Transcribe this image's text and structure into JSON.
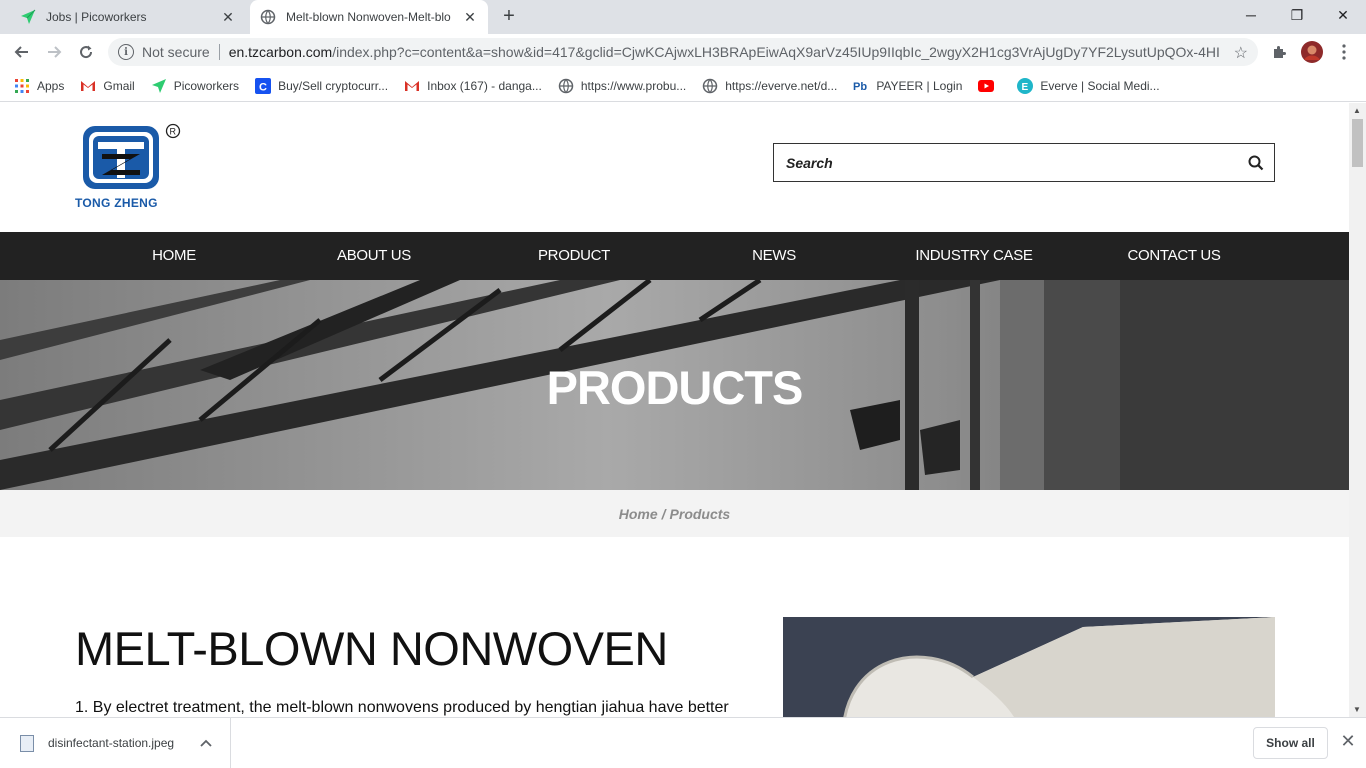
{
  "browser": {
    "tabs": [
      {
        "title": "Jobs | Picoworkers",
        "active": false,
        "icon": "paper-plane-icon"
      },
      {
        "title": "Melt-blown Nonwoven-Melt-blo",
        "active": true,
        "icon": "globe-icon"
      }
    ],
    "security_label": "Not secure",
    "url_host": "en.tzcarbon.com",
    "url_rest": "/index.php?c=content&a=show&id=417&gclid=CjwKCAjwxLH3BRApEiwAqX9arVz45IUp9IIqbIc_2wgyX2H1cg3VrAjUgDy7YF2LysutUpQOx-4HI..."
  },
  "bookmarks": [
    {
      "label": "Apps",
      "icon": "apps-grid-icon"
    },
    {
      "label": "Gmail",
      "icon": "gmail-icon"
    },
    {
      "label": "Picoworkers",
      "icon": "paper-plane-icon"
    },
    {
      "label": "Buy/Sell cryptocurr...",
      "icon": "c-logo-icon"
    },
    {
      "label": "Inbox (167) - danga...",
      "icon": "gmail-icon"
    },
    {
      "label": "https://www.probu...",
      "icon": "globe-icon"
    },
    {
      "label": "https://everve.net/d...",
      "icon": "globe-icon"
    },
    {
      "label": "PAYEER | Login",
      "icon": "payeer-icon"
    },
    {
      "label": "",
      "icon": "youtube-icon"
    },
    {
      "label": "Everve | Social Medi...",
      "icon": "everve-icon"
    }
  ],
  "site": {
    "logo_text": "TONG ZHENG",
    "search_placeholder": "Search",
    "nav": [
      "HOME",
      "ABOUT US",
      "PRODUCT",
      "NEWS",
      "INDUSTRY CASE",
      "CONTACT US"
    ],
    "banner_title": "PRODUCTS",
    "breadcrumb": {
      "home": "Home",
      "separator": "/",
      "current": "Products"
    },
    "product_title": "MELT-BLOWN NONWOVEN",
    "product_desc": "1. By electret treatment, the melt-blown nonwovens produced by hengtian jiahua have better"
  },
  "downloads": {
    "file_name": "disinfectant-station.jpeg",
    "show_all_label": "Show all"
  },
  "colors": {
    "nav_bg": "#222222",
    "logo_blue": "#1a5aa8",
    "breadcrumb_text": "#8c8c8c"
  }
}
